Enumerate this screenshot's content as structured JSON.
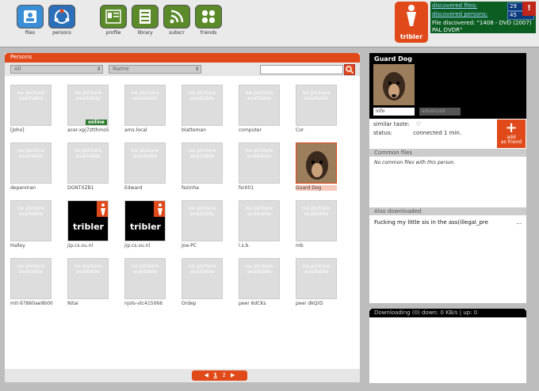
{
  "toolbar": {
    "buttons": [
      {
        "label": "files",
        "icon": "files-icon"
      },
      {
        "label": "persons",
        "icon": "persons-icon"
      },
      {
        "label": "profile",
        "icon": "profile-icon"
      },
      {
        "label": "library",
        "icon": "library-icon"
      },
      {
        "label": "subscr",
        "icon": "subscriptions-icon"
      },
      {
        "label": "friends",
        "icon": "friends-icon"
      }
    ]
  },
  "logo": {
    "text": "tribler"
  },
  "stats": {
    "discovered_files_label": "discovered files:",
    "discovered_files_value": "29",
    "discovered_persons_label": "discovered persons:",
    "discovered_persons_value": "45",
    "file_discovered": "File discovered: \"1408 - DVD (2007) PAL DVDR\"",
    "alert": "!"
  },
  "persons": {
    "title": "Persons",
    "filter1": "All",
    "filter2": "Name",
    "search_placeholder": "",
    "no_picture_line1": "no picture",
    "no_picture_line2": "available",
    "online_label": "online",
    "tribler_thumb_text": "tribler",
    "people": [
      {
        "name": "[Joho]",
        "pic": "none"
      },
      {
        "name": "acer-xpj7ztthmo5",
        "pic": "none",
        "online": true
      },
      {
        "name": "ams.local",
        "pic": "none"
      },
      {
        "name": "blatteman",
        "pic": "none"
      },
      {
        "name": "computer",
        "pic": "none"
      },
      {
        "name": "Cor",
        "pic": "none"
      },
      {
        "name": "depanman",
        "pic": "none"
      },
      {
        "name": "DGNTXZB1",
        "pic": "none"
      },
      {
        "name": "Edward",
        "pic": "none"
      },
      {
        "name": "fezinha",
        "pic": "none"
      },
      {
        "name": "fsnt01",
        "pic": "none"
      },
      {
        "name": "Guard Dog",
        "pic": "dog",
        "selected": true
      },
      {
        "name": "Halley",
        "pic": "none"
      },
      {
        "name": "jip.cs.vu.nl",
        "pic": "tribler"
      },
      {
        "name": "jip.cs.vu.nl",
        "pic": "tribler"
      },
      {
        "name": "Joe-PC",
        "pic": "none"
      },
      {
        "name": "l.s.b.",
        "pic": "none"
      },
      {
        "name": "mb",
        "pic": "none"
      },
      {
        "name": "mit-97860ae9b00",
        "pic": "none"
      },
      {
        "name": "Nitai",
        "pic": "none"
      },
      {
        "name": "njols-vtc415066",
        "pic": "none"
      },
      {
        "name": "Ordep",
        "pic": "none"
      },
      {
        "name": "peer 6dCKs",
        "pic": "none"
      },
      {
        "name": "peer dkQrD",
        "pic": "none"
      }
    ],
    "pager": {
      "prev": "◀",
      "page1": "1",
      "page2": "2",
      "next": "▶"
    }
  },
  "detail": {
    "name": "Guard Dog",
    "tab_info": "info",
    "tab_advanced": "advanced",
    "similar_taste_label": "similar taste:",
    "status_label": "status:",
    "status_value": "connected  1 min.",
    "add_friend_label_1": "add",
    "add_friend_label_2": "as friend",
    "common_files_title": "Common files",
    "common_files_text": "No common files with this person.",
    "also_downloaded_title": "Also downloaded",
    "also_downloaded_item": "Fucking my little sis in the ass(illegal_pre",
    "also_downloaded_more": "..."
  },
  "downloads": {
    "text": "Downloading (0)   down: 0 KB/s | up: 0"
  },
  "colors": {
    "accent": "#e04a1a",
    "stats_bg": "#0b5d22"
  }
}
